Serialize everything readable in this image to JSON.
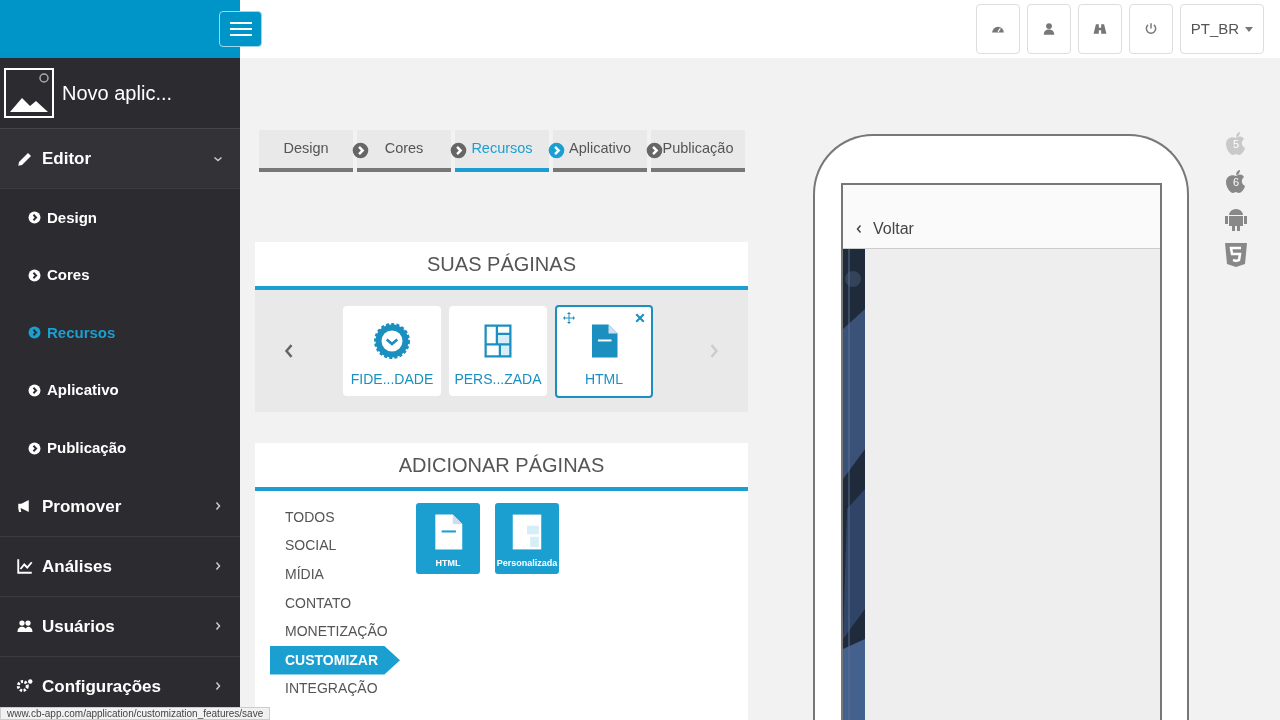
{
  "app": {
    "name": "Novo aplic..."
  },
  "sidebar": {
    "items": [
      {
        "label": "Editor",
        "expanded": true,
        "children": [
          {
            "label": "Design",
            "selected": false
          },
          {
            "label": "Cores",
            "selected": false
          },
          {
            "label": "Recursos",
            "selected": true
          },
          {
            "label": "Aplicativo",
            "selected": false
          },
          {
            "label": "Publicação",
            "selected": false
          }
        ]
      },
      {
        "label": "Promover",
        "expanded": false
      },
      {
        "label": "Análises",
        "expanded": false
      },
      {
        "label": "Usuários",
        "expanded": false
      },
      {
        "label": "Configurações",
        "expanded": false
      }
    ]
  },
  "toolbar": {
    "language": "PT_BR"
  },
  "steps": [
    {
      "label": "Design",
      "selected": false
    },
    {
      "label": "Cores",
      "selected": false
    },
    {
      "label": "Recursos",
      "selected": true
    },
    {
      "label": "Aplicativo",
      "selected": false
    },
    {
      "label": "Publicação",
      "selected": false
    }
  ],
  "your_pages": {
    "title": "SUAS PÁGINAS",
    "pages": [
      {
        "label": "FIDE...DADE",
        "kind": "badge",
        "selected": false
      },
      {
        "label": "PERS...ZADA",
        "kind": "layout",
        "selected": false
      },
      {
        "label": "HTML",
        "kind": "html",
        "selected": true
      }
    ]
  },
  "add_pages": {
    "title": "ADICIONAR PÁGINAS",
    "categories": [
      {
        "label": "TODOS",
        "selected": false
      },
      {
        "label": "SOCIAL",
        "selected": false
      },
      {
        "label": "MÍDIA",
        "selected": false
      },
      {
        "label": "CONTATO",
        "selected": false
      },
      {
        "label": "MONETIZAÇÃO",
        "selected": false
      },
      {
        "label": "CUSTOMIZAR",
        "selected": true
      },
      {
        "label": "INTEGRAÇÃO",
        "selected": false
      }
    ],
    "tiles": [
      {
        "label": "HTML",
        "kind": "html"
      },
      {
        "label": "Personalizada",
        "kind": "layout"
      }
    ]
  },
  "preview": {
    "back_label": "Voltar"
  },
  "platforms": [
    {
      "kind": "apple",
      "label": "5",
      "disabled": true
    },
    {
      "kind": "apple",
      "label": "6",
      "disabled": false
    },
    {
      "kind": "android",
      "disabled": false
    },
    {
      "kind": "html5",
      "disabled": false
    }
  ],
  "status_bar": "www.cb-app.com/application/customization_features/save"
}
